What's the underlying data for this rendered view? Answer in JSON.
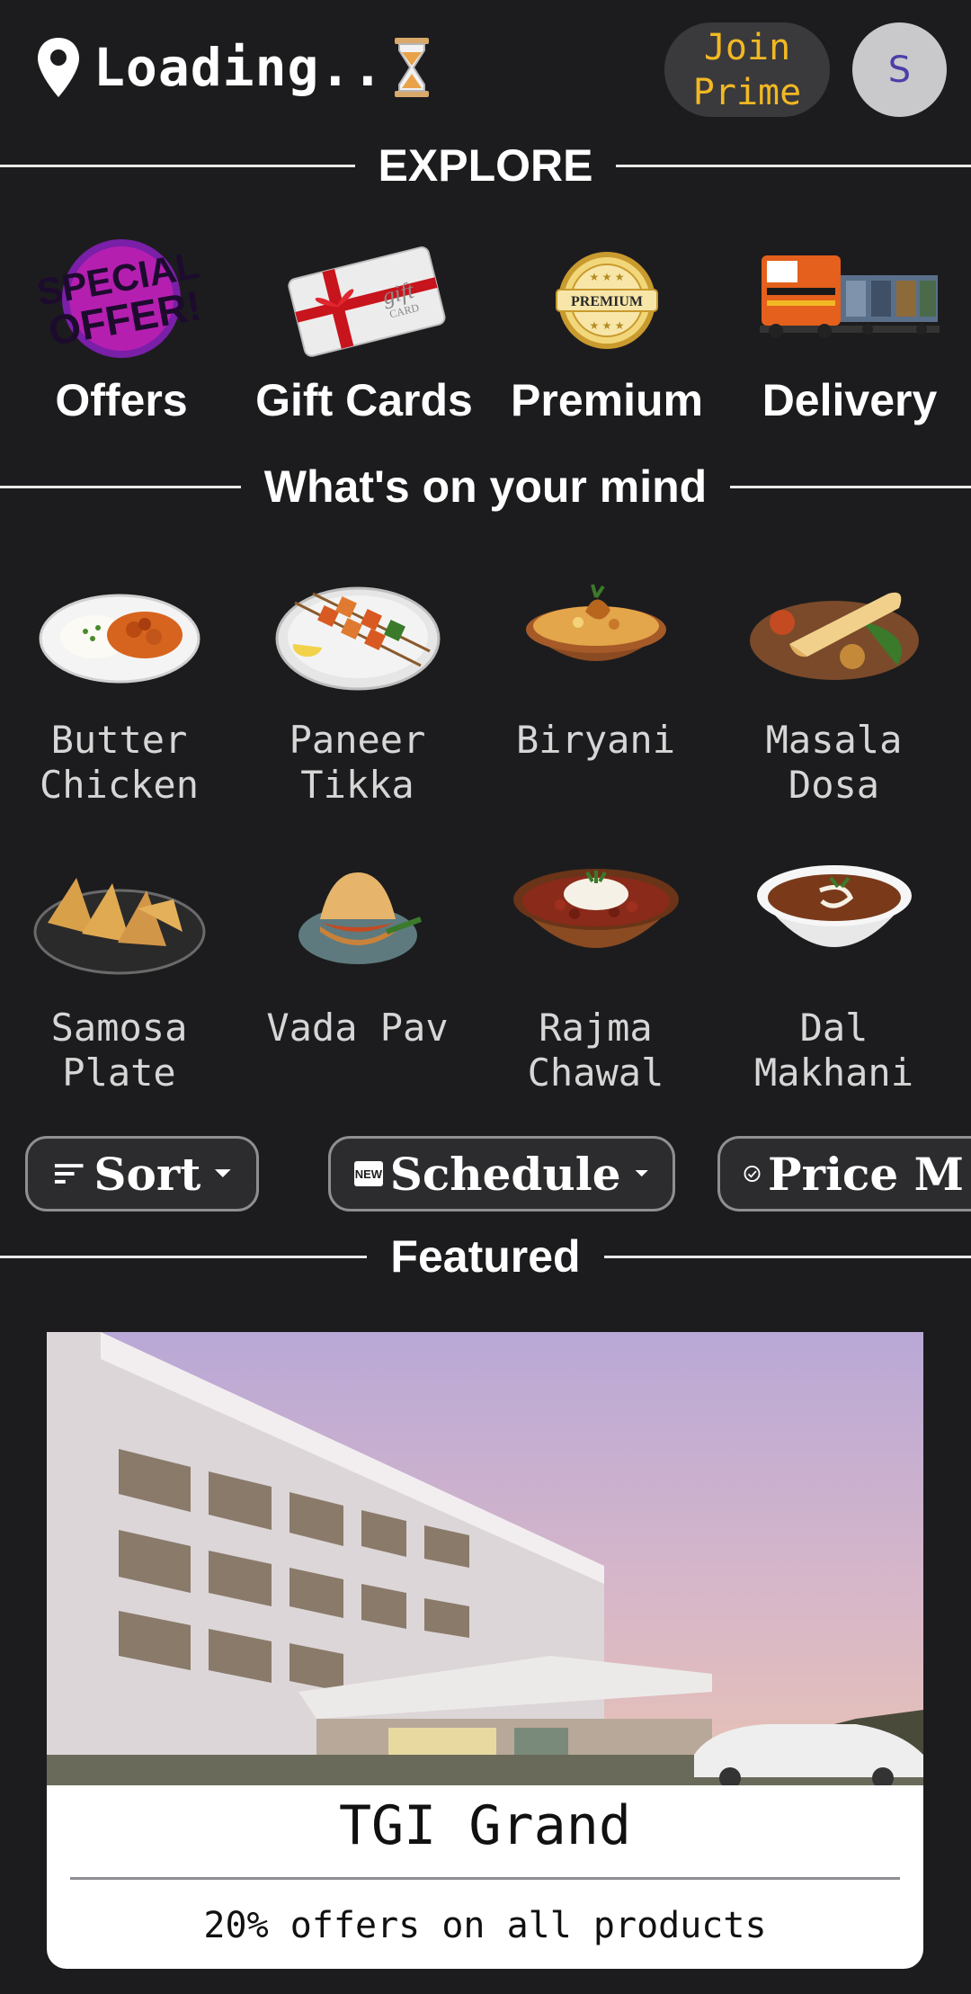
{
  "header": {
    "location_text": "Loading..",
    "join_line1": "Join",
    "join_line2": "Prime",
    "avatar_initial": "S"
  },
  "explore": {
    "title": "EXPLORE",
    "items": [
      {
        "label": "Offers",
        "icon": "special-offer-badge"
      },
      {
        "label": "Gift Cards",
        "icon": "gift-card"
      },
      {
        "label": "Premium",
        "icon": "premium-badge"
      },
      {
        "label": "Delivery",
        "icon": "train"
      }
    ]
  },
  "mind": {
    "title": "What's on your mind",
    "items": [
      {
        "line1": "Butter",
        "line2": "Chicken"
      },
      {
        "line1": "Paneer",
        "line2": "Tikka"
      },
      {
        "line1": "Biryani",
        "line2": ""
      },
      {
        "line1": "Masala",
        "line2": "Dosa"
      },
      {
        "line1": "Samosa",
        "line2": "Plate"
      },
      {
        "line1": "Vada Pav",
        "line2": ""
      },
      {
        "line1": "Rajma",
        "line2": "Chawal"
      },
      {
        "line1": "Dal",
        "line2": "Makhani"
      }
    ]
  },
  "filters": {
    "sort_label": "Sort",
    "schedule_label": "Schedule",
    "schedule_badge": "NEW",
    "price_label": "Price M"
  },
  "featured": {
    "title": "Featured",
    "card_title": "TGI Grand",
    "card_subtitle": "20% offers on all products"
  },
  "colors": {
    "background": "#1c1c1e",
    "accent": "#f2b824",
    "avatar_bg": "#c9c9cc",
    "avatar_text": "#4c3fa8"
  }
}
